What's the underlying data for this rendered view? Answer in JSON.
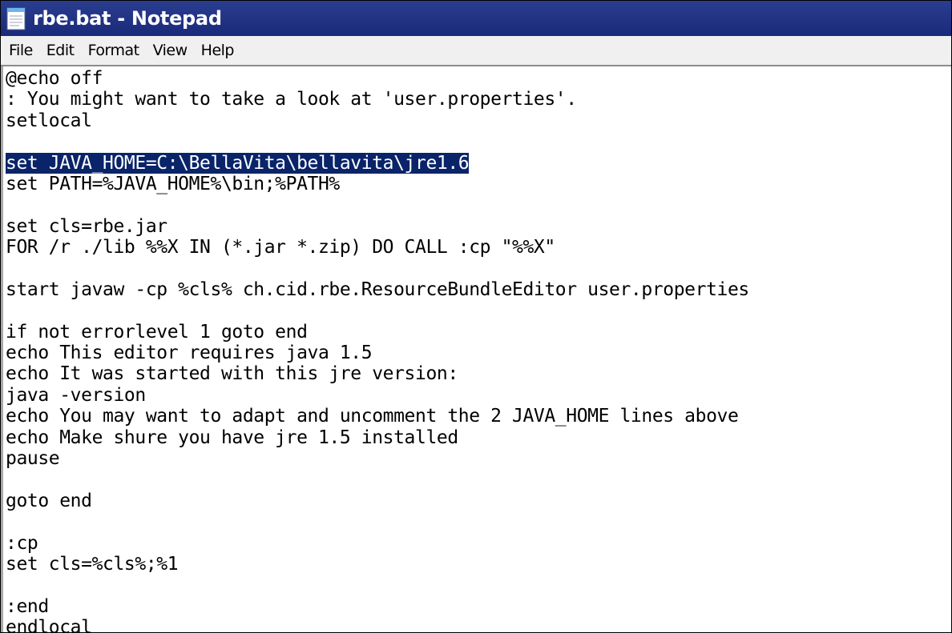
{
  "window": {
    "title": "rbe.bat - Notepad",
    "icon": "notepad-icon"
  },
  "menu": {
    "items": [
      "File",
      "Edit",
      "Format",
      "View",
      "Help"
    ]
  },
  "editor": {
    "lines": [
      "@echo off",
      ": You might want to take a look at 'user.properties'.",
      "setlocal",
      "",
      "set JAVA_HOME=C:\\BellaVita\\bellavita\\jre1.6",
      "set PATH=%JAVA_HOME%\\bin;%PATH%",
      "",
      "set cls=rbe.jar",
      "FOR /r ./lib %%X IN (*.jar *.zip) DO CALL :cp \"%%X\"",
      "",
      "start javaw -cp %cls% ch.cid.rbe.ResourceBundleEditor user.properties",
      "",
      "if not errorlevel 1 goto end",
      "echo This editor requires java 1.5",
      "echo It was started with this jre version:",
      "java -version",
      "echo You may want to adapt and uncomment the 2 JAVA_HOME lines above",
      "echo Make shure you have jre 1.5 installed",
      "pause",
      "",
      "goto end",
      "",
      ":cp",
      "set cls=%cls%;%1",
      "",
      ":end",
      "endlocal"
    ],
    "selected_line_index": 4
  },
  "colors": {
    "titlebar": "#1f3185",
    "selection": "#0a246a",
    "menubar": "#f0f0f0"
  }
}
